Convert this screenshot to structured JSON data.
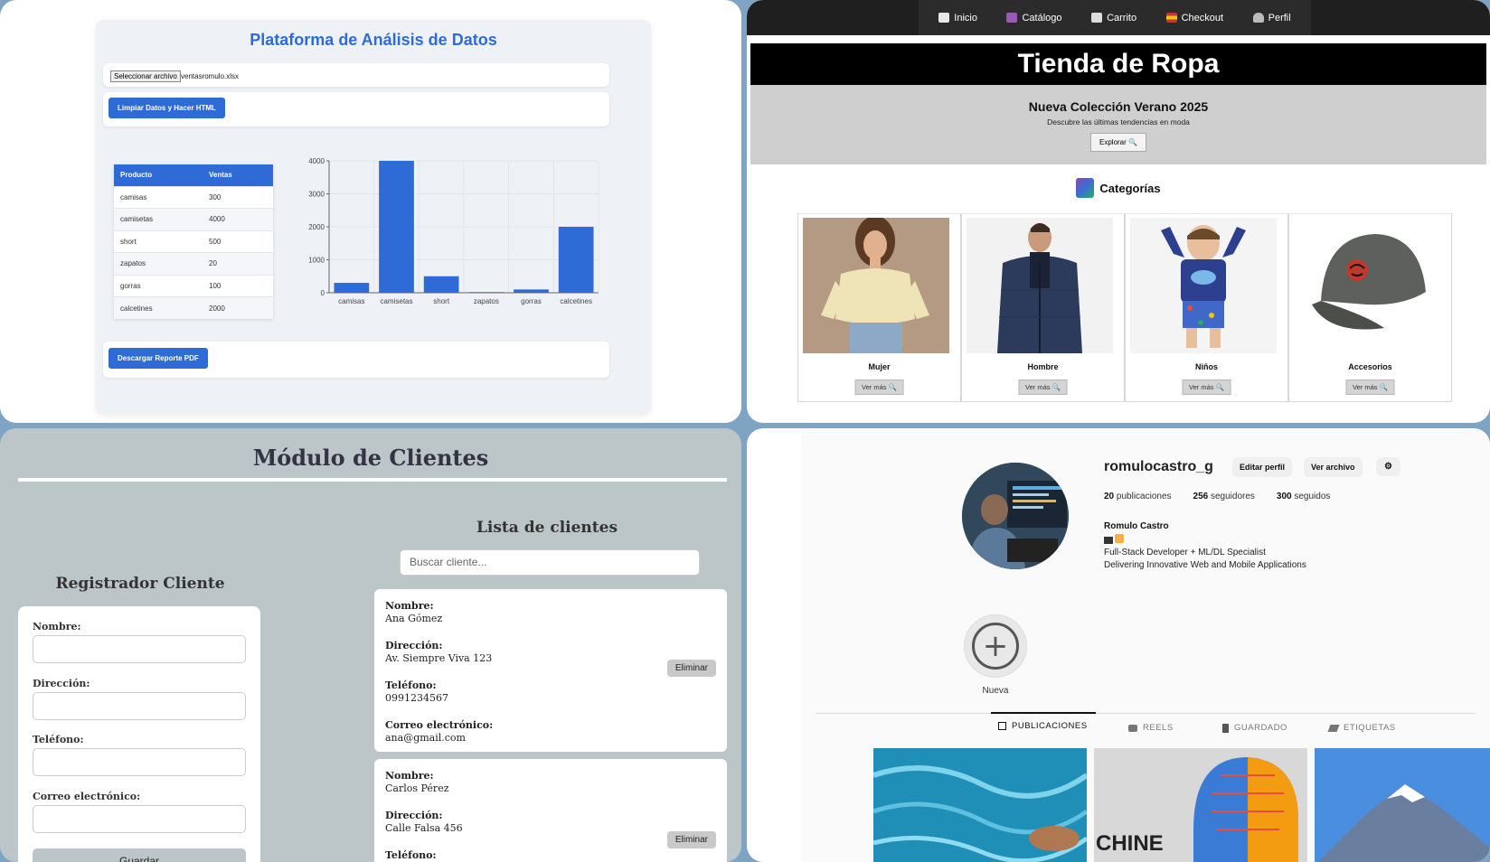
{
  "analytics": {
    "title": "Plataforma de Análisis de Datos",
    "file_button": "Seleccionar archivo",
    "file_name": "ventasromulo.xlsx",
    "clean_button": "Limpiar Datos y Hacer HTML",
    "pdf_button": "Descargar Reporte PDF",
    "table": {
      "headers": [
        "Producto",
        "Ventas"
      ],
      "rows": [
        [
          "camisas",
          "300"
        ],
        [
          "camisetas",
          "4000"
        ],
        [
          "short",
          "500"
        ],
        [
          "zapatos",
          "20"
        ],
        [
          "gorras",
          "100"
        ],
        [
          "calcetines",
          "2000"
        ]
      ]
    },
    "chart_data": {
      "type": "bar",
      "categories": [
        "camisas",
        "camisetas",
        "short",
        "zapatos",
        "gorras",
        "calcetines"
      ],
      "values": [
        300,
        4000,
        500,
        20,
        100,
        2000
      ],
      "yticks": [
        0,
        1000,
        2000,
        3000,
        4000
      ],
      "ylim": [
        0,
        4000
      ],
      "grid": true,
      "color": "#2f6bd6"
    }
  },
  "shop": {
    "nav": [
      {
        "label": "Inicio",
        "icon": "home-icon",
        "color": "#e8e8e8"
      },
      {
        "label": "Catálogo",
        "icon": "shopping-bags-icon",
        "color": "#9b59b6"
      },
      {
        "label": "Carrito",
        "icon": "cart-icon",
        "color": "#dddddd"
      },
      {
        "label": "Checkout",
        "icon": "flag-icon",
        "color": "#f1c40f"
      },
      {
        "label": "Perfil",
        "icon": "user-icon",
        "color": "#bbbbbb"
      }
    ],
    "title": "Tienda de Ropa",
    "hero_title": "Nueva Colección Verano 2025",
    "hero_sub": "Descubre las últimas tendencias en moda",
    "explore_button": "Explorar 🔍",
    "categories_title": "Categorías",
    "categories": [
      {
        "name": "Mujer",
        "button": "Ver más 🔍"
      },
      {
        "name": "Hombre",
        "button": "Ver más 🔍"
      },
      {
        "name": "Niños",
        "button": "Ver más 🔍"
      },
      {
        "name": "Accesorios",
        "button": "Ver más 🔍"
      }
    ]
  },
  "clients": {
    "title": "Módulo de Clientes",
    "register_title": "Registrador Cliente",
    "fields": [
      "Nombre:",
      "Dirección:",
      "Teléfono:",
      "Correo electrónico:"
    ],
    "save_button": "Guardar",
    "list_title": "Lista de clientes",
    "search_placeholder": "Buscar cliente...",
    "delete_button": "Eliminar",
    "list": [
      {
        "nombre": "Ana Gómez",
        "direccion": "Av. Siempre Viva 123",
        "telefono": "0991234567",
        "correo": "ana@gmail.com"
      },
      {
        "nombre": "Carlos Pérez",
        "direccion": "Calle Falsa 456",
        "telefono": "",
        "correo": ""
      }
    ]
  },
  "profile": {
    "username": "romulocastro_g",
    "edit_button": "Editar perfil",
    "archive_button": "Ver archivo",
    "settings_icon": "gear-icon",
    "posts_count": "20",
    "posts_label": "publicaciones",
    "followers_count": "256",
    "followers_label": "seguidores",
    "following_count": "300",
    "following_label": "seguidos",
    "name": "Romulo Castro",
    "bio_line1": "Full-Stack Developer + ML/DL Specialist",
    "bio_line2": "Delivering Innovative Web and Mobile Applications",
    "highlight_label": "Nueva",
    "tabs": [
      "PUBLICACIONES",
      "REELS",
      "GUARDADO",
      "ETIQUETAS"
    ],
    "post2_text": "CHINE"
  }
}
